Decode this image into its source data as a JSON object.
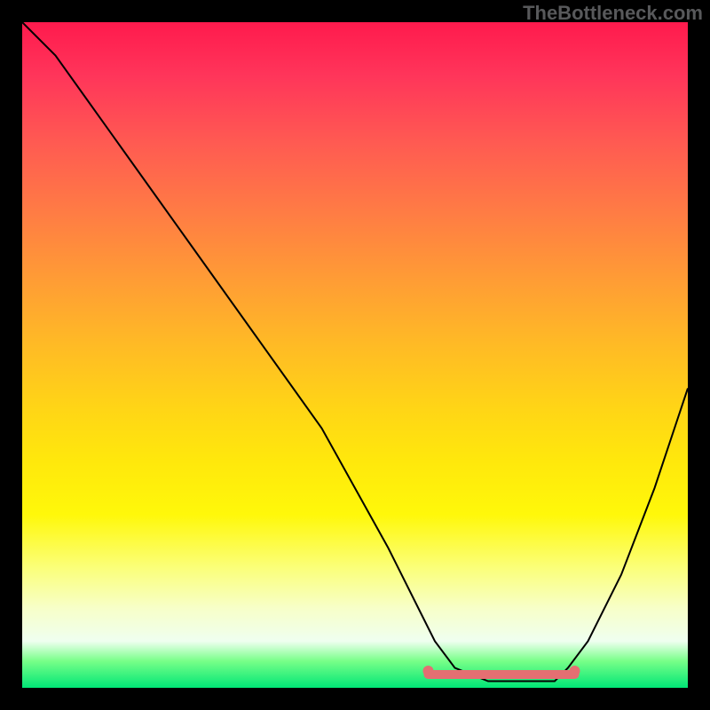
{
  "credit": "TheBottleneck.com",
  "colors": {
    "frame": "#000000",
    "curve": "#000000",
    "band": "#e46f72"
  },
  "chart_data": {
    "type": "line",
    "title": "",
    "xlabel": "",
    "ylabel": "",
    "xlim": [
      0,
      100
    ],
    "ylim": [
      0,
      100
    ],
    "grid": false,
    "legend": false,
    "series": [
      {
        "name": "bottleneck-curve",
        "x": [
          0,
          5,
          10,
          15,
          20,
          25,
          30,
          35,
          40,
          45,
          50,
          55,
          60,
          62,
          65,
          70,
          75,
          80,
          82,
          85,
          90,
          95,
          100
        ],
        "y": [
          100,
          95,
          88,
          81,
          74,
          67,
          60,
          53,
          46,
          39,
          30,
          21,
          11,
          7,
          3,
          1,
          1,
          1,
          3,
          7,
          17,
          30,
          45
        ]
      }
    ],
    "highlight_band": {
      "name": "optimal-range",
      "x_start": 61,
      "x_end": 83,
      "y": 2
    }
  }
}
